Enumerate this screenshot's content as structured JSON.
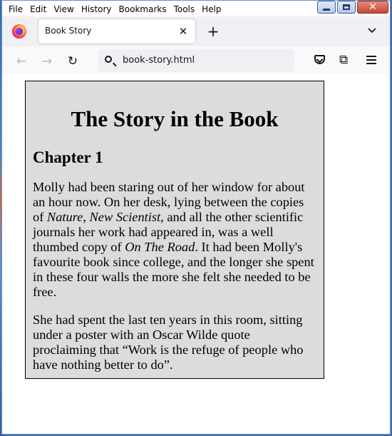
{
  "window": {
    "menu": [
      "File",
      "Edit",
      "View",
      "History",
      "Bookmarks",
      "Tools",
      "Help"
    ],
    "controls": {
      "minimize": "–",
      "maximize": "□",
      "close": "✕"
    }
  },
  "browser": {
    "tab_title": "Book Story",
    "tab_close": "✕",
    "new_tab": "+",
    "tab_list": "⌄",
    "back": "←",
    "forward": "→",
    "reload": "↻",
    "url": "book-story.html",
    "extensions": "⧉",
    "icons": [
      "firefox-logo",
      "search-icon",
      "pocket-icon",
      "extensions-icon",
      "menu-icon"
    ]
  },
  "page": {
    "title": "The Story in the Book",
    "chapter": "Chapter 1",
    "p1": {
      "a": "Molly had been staring out of her window for about an hour now. On her desk, lying between the copies of ",
      "nature": "Nature",
      "b": ", ",
      "new_scientist": "New Scientist",
      "c": ", and all the other scientific journals her work had appeared in, was a well thumbed copy of ",
      "on_the_road": "On The Road",
      "d": ". It had been Molly's favourite book since college, and the longer she spent in these four walls the more she felt she needed to be free."
    },
    "p2": "She had spent the last ten years in this room, sitting under a poster with an Oscar Wilde quote proclaiming that “Work is the refuge of people who have nothing better to do”."
  }
}
